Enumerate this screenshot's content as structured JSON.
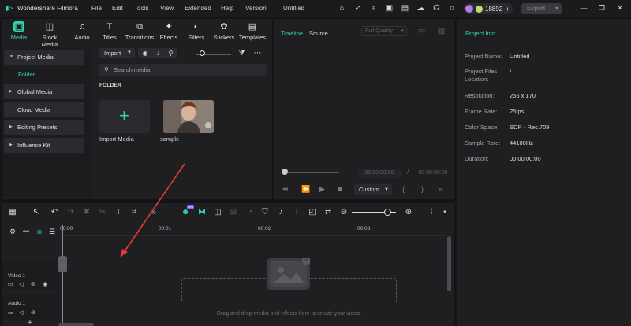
{
  "titlebar": {
    "app_name": "Wondershare Filmora",
    "menus": [
      "File",
      "Edit",
      "Tools",
      "View",
      "Extended",
      "Help",
      "Version"
    ],
    "project_name": "Untitled",
    "credits": "18892",
    "export_label": "Export"
  },
  "media_panel": {
    "tabs": [
      "Media",
      "Stock Media",
      "Audio",
      "Titles",
      "Transitions",
      "Effects",
      "Filters",
      "Stickers",
      "Templates"
    ],
    "sidebar": {
      "project_media": "Project Media",
      "folder": "Folder",
      "global_media": "Global Media",
      "cloud_media": "Cloud Media",
      "editing_presets": "Editing Presets",
      "influence_kit": "Influence Kit"
    },
    "import_label": "Import",
    "search_placeholder": "Search media",
    "folder_heading": "FOLDER",
    "tiles": [
      {
        "label": "Import Media"
      },
      {
        "label": "sample"
      }
    ]
  },
  "preview_panel": {
    "tab_timeline": "Timeline",
    "tab_source": "Source",
    "quality": "Full Quality",
    "current_time": "00:00:00:00",
    "separator": "/",
    "total_time": "00:00:00:00",
    "ratio_label": "Custom"
  },
  "project_info": {
    "title": "Project Info",
    "rows": [
      {
        "key": "Project Name:",
        "value": "Untitled"
      },
      {
        "key": "Project Files Location:",
        "value": "/"
      },
      {
        "key": "Resolution:",
        "value": "256 x 170"
      },
      {
        "key": "Frame Rate:",
        "value": "25fps"
      },
      {
        "key": "Color Space:",
        "value": "SDR - Rec.709"
      },
      {
        "key": "Sample Rate:",
        "value": "44100Hz"
      },
      {
        "key": "Duration:",
        "value": "00:00:00:00"
      }
    ]
  },
  "timeline": {
    "ruler": [
      "00:00",
      "00:01",
      "00:02",
      "00:03"
    ],
    "tracks": [
      "Video 1",
      "Audio 1"
    ],
    "drop_hint": "Drag and drop media and effects here to create your video.",
    "ai_badge": "ON"
  },
  "colors": {
    "accent": "#2fd6b0",
    "annotation_arrow": "#e03a3a"
  }
}
